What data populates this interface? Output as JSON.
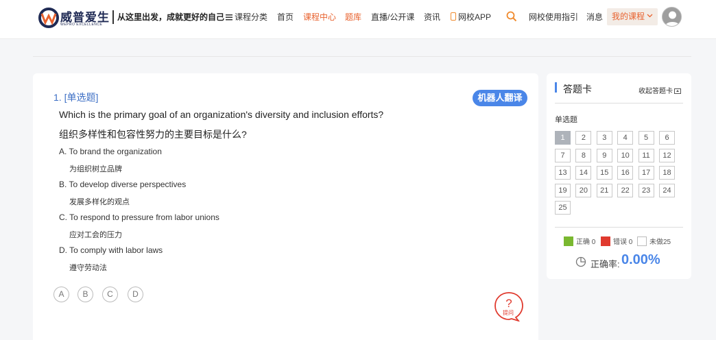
{
  "header": {
    "brand": "威普爱生",
    "brand_sub": "WEPRO EXCELLENCE",
    "slogan": "从这里出发，成就更好的自己",
    "nav": {
      "categories": "课程分类",
      "home": "首页",
      "course_center": "课程中心",
      "question_bank": "题库",
      "live": "直播/公开课",
      "news": "资讯",
      "app": "网校APP",
      "guide": "网校使用指引",
      "messages": "消息",
      "my_courses": "我的课程"
    },
    "colors": {
      "accent": "#e8622e",
      "primary": "#4a86e8"
    }
  },
  "question": {
    "type_label": "1. [单选题]",
    "translate_label": "机器人翻译",
    "text_en": "Which is the primary goal of an organization's diversity and inclusion efforts?",
    "text_cn": "组织多样性和包容性努力的主要目标是什么?",
    "options": [
      {
        "en": "A.  To brand the organization",
        "cn": "为组织树立品牌"
      },
      {
        "en": "B.  To develop diverse perspectives",
        "cn": "发展多样化的观点"
      },
      {
        "en": "C.  To respond to pressure from labor unions",
        "cn": "应对工会的压力"
      },
      {
        "en": "D.  To comply with labor laws",
        "cn": "遵守劳动法"
      }
    ],
    "answer_buttons": [
      "A",
      "B",
      "C",
      "D"
    ],
    "ask_label": "提问"
  },
  "answer_card": {
    "title": "答题卡",
    "collapse_label": "收起答题卡",
    "section_label": "单选题",
    "numbers": [
      "1",
      "2",
      "3",
      "4",
      "5",
      "6",
      "7",
      "8",
      "9",
      "10",
      "11",
      "12",
      "13",
      "14",
      "15",
      "16",
      "17",
      "18",
      "19",
      "20",
      "21",
      "22",
      "23",
      "24",
      "25"
    ],
    "current": "1",
    "legend": {
      "correct": "正确 0",
      "wrong": "错误 0",
      "undone": "未做25",
      "correct_color": "#7ab830",
      "wrong_color": "#e03a2e"
    },
    "rate_label": "正确率:",
    "rate_value": "0.00%"
  }
}
